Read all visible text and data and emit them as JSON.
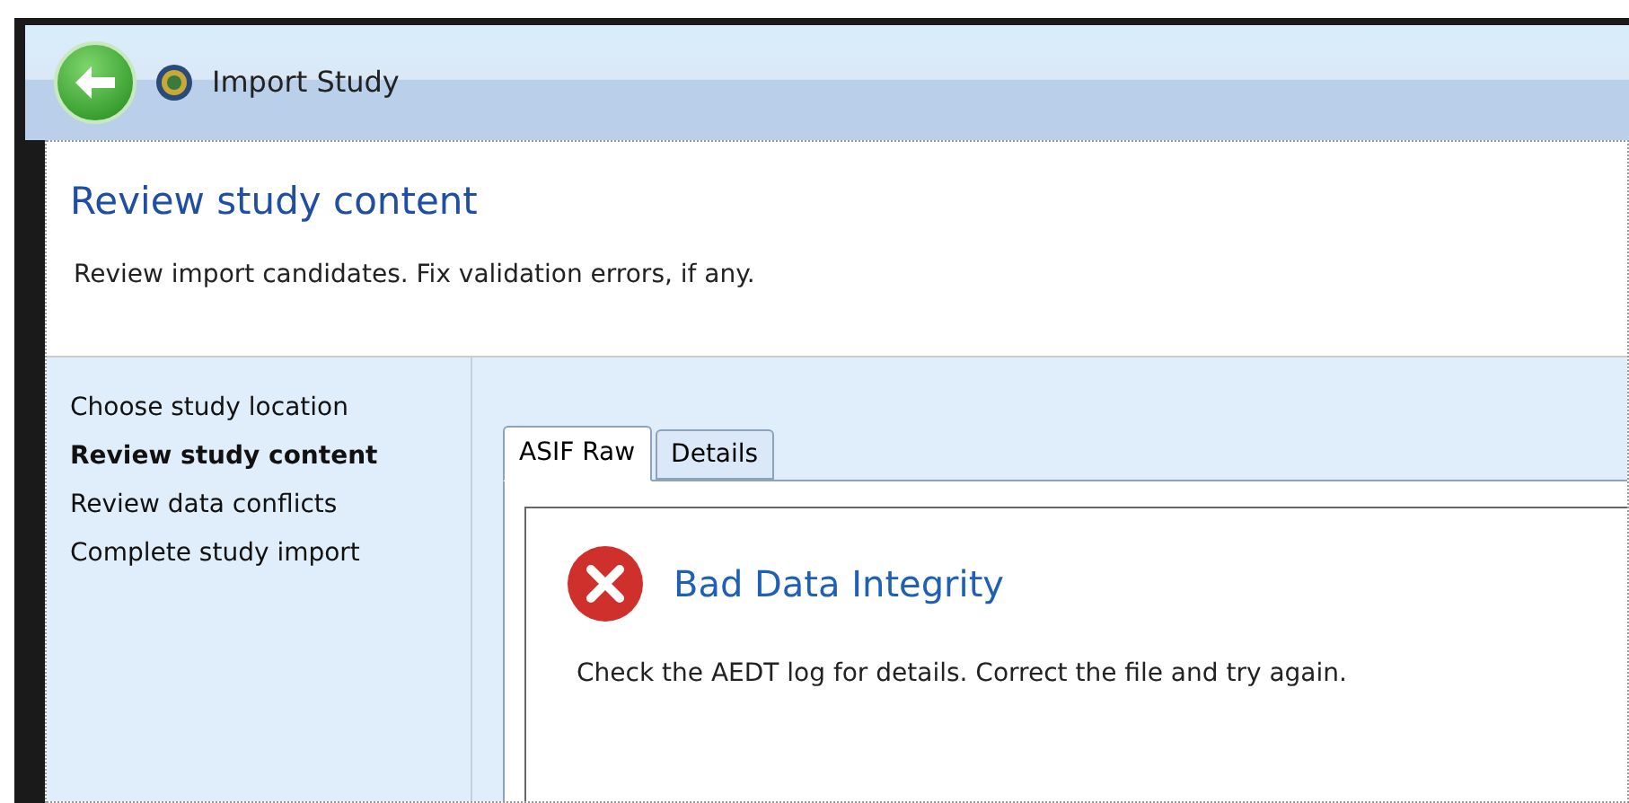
{
  "window": {
    "title": "Import Study"
  },
  "header": {
    "title": "Review study content",
    "subtitle": "Review import candidates. Fix validation errors, if any."
  },
  "steps": [
    {
      "label": "Choose study location",
      "selected": false
    },
    {
      "label": "Review study content",
      "selected": true
    },
    {
      "label": "Review data conflicts",
      "selected": false
    },
    {
      "label": "Complete study import",
      "selected": false
    }
  ],
  "tabs": [
    {
      "label": "ASIF Raw",
      "selected": true
    },
    {
      "label": "Details",
      "selected": false
    }
  ],
  "message": {
    "kind": "error",
    "title": "Bad Data Integrity",
    "text": "Check the AEDT log for details. Correct the file and try again."
  }
}
